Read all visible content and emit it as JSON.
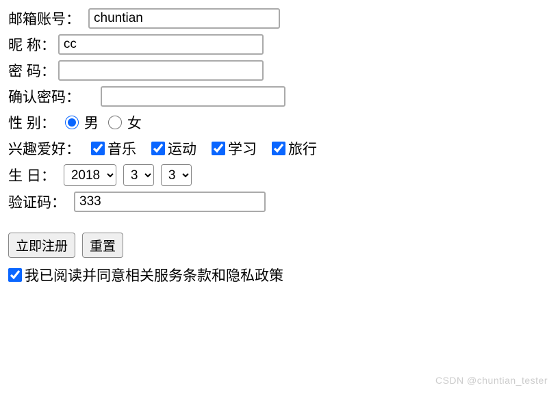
{
  "form": {
    "email": {
      "label": "邮箱账号：",
      "value": "chuntian"
    },
    "nickname": {
      "label": "昵 称：",
      "value": "cc"
    },
    "password": {
      "label": "密 码：",
      "value": ""
    },
    "confirm": {
      "label": "确认密码：",
      "value": ""
    },
    "gender": {
      "label": "性 别：",
      "options": {
        "male": "男",
        "female": "女"
      },
      "selected": "male"
    },
    "hobby": {
      "label": "兴趣爱好：",
      "items": [
        {
          "label": "音乐",
          "checked": true
        },
        {
          "label": "运动",
          "checked": true
        },
        {
          "label": "学习",
          "checked": true
        },
        {
          "label": "旅行",
          "checked": true
        }
      ]
    },
    "birthday": {
      "label": "生 日：",
      "year": "2018",
      "month": "3",
      "day": "3"
    },
    "captcha": {
      "label": "验证码：",
      "value": "333"
    },
    "buttons": {
      "submit": "立即注册",
      "reset": "重置"
    },
    "agree": {
      "label": "我已阅读并同意相关服务条款和隐私政策",
      "checked": true
    }
  },
  "watermark": "CSDN @chuntian_tester"
}
